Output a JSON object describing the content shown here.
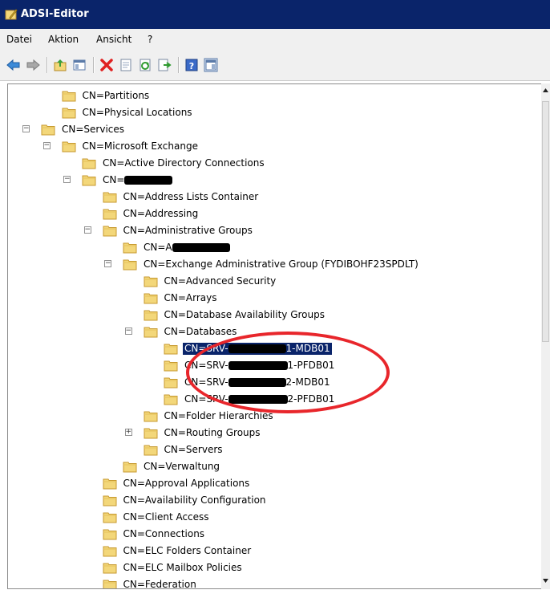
{
  "window": {
    "title": "ADSI-Editor"
  },
  "menu": [
    "Datei",
    "Aktion",
    "Ansicht",
    "?"
  ],
  "toolbar": {
    "icons": [
      "back-icon",
      "forward-icon",
      "up-folder-icon",
      "show-hide-console-tree-icon",
      "delete-icon",
      "properties-icon",
      "refresh-icon",
      "export-list-icon",
      "help-icon",
      "show-hide-action-pane-icon"
    ]
  },
  "tree": {
    "items": [
      {
        "label": "CN=Partitions"
      },
      {
        "label": "CN=Physical Locations"
      },
      {
        "label": "CN=Services",
        "expander": "−"
      },
      {
        "label": "CN=Microsoft Exchange",
        "expander": "−"
      },
      {
        "label": "CN=Active Directory Connections"
      },
      {
        "label": "CN=",
        "expander": "−"
      },
      {
        "label": "CN=Address Lists Container"
      },
      {
        "label": "CN=Addressing"
      },
      {
        "label": "CN=Administrative Groups",
        "expander": "−"
      },
      {
        "label": "CN=A"
      },
      {
        "label": "CN=Exchange Administrative Group (FYDIBOHF23SPDLT)",
        "expander": "−"
      },
      {
        "label": "CN=Advanced Security"
      },
      {
        "label": "CN=Arrays"
      },
      {
        "label": "CN=Database Availability Groups"
      },
      {
        "label": "CN=Databases",
        "expander": "−"
      },
      {
        "label_pre": "CN=SRV-",
        "label_post": "1-MDB01"
      },
      {
        "label_pre": "CN=SRV-",
        "label_post": "1-PFDB01"
      },
      {
        "label_pre": "CN=SRV-",
        "label_post": "2-MDB01"
      },
      {
        "label_pre": "CN=SRV-",
        "label_post": "2-PFDB01"
      },
      {
        "label": "CN=Folder Hierarchies"
      },
      {
        "label": "CN=Routing Groups",
        "expander": "+"
      },
      {
        "label": "CN=Servers"
      },
      {
        "label": "CN=Verwaltung"
      },
      {
        "label": "CN=Approval Applications"
      },
      {
        "label": "CN=Availability Configuration"
      },
      {
        "label": "CN=Client Access"
      },
      {
        "label": "CN=Connections"
      },
      {
        "label": "CN=ELC Folders Container"
      },
      {
        "label": "CN=ELC Mailbox Policies"
      },
      {
        "label": "CN=Federation"
      }
    ]
  },
  "colors": {
    "titlebar": "#0a246a",
    "selection": "#0a246a",
    "annotation": "#e8262b",
    "folder": "#f3d77a"
  }
}
